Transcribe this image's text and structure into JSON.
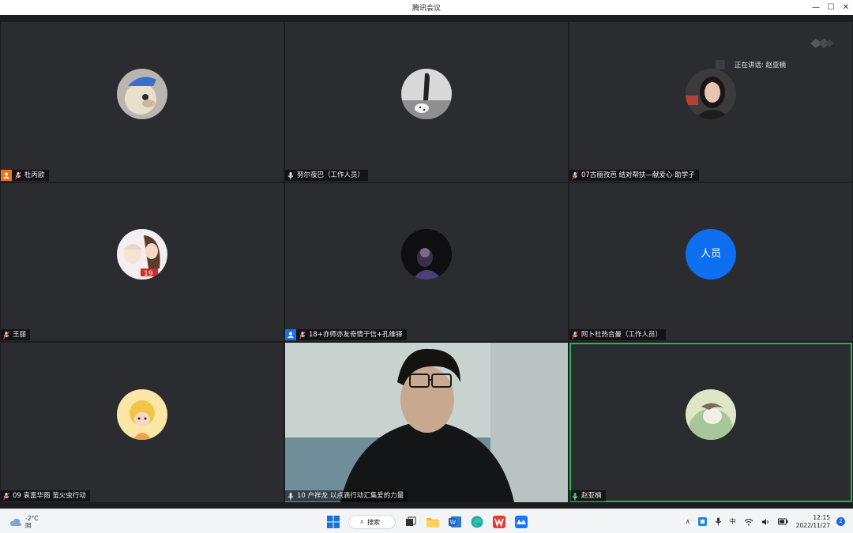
{
  "window": {
    "title": "腾讯会议",
    "min": "—",
    "max": "☐",
    "close": "✕"
  },
  "speaking": {
    "label": "正在讲话: 赵亚楠"
  },
  "participants": [
    {
      "name": "杜丙欧",
      "host": "orange",
      "mic": "muted"
    },
    {
      "name": "努尔夜巴（工作人员）",
      "mic": "on"
    },
    {
      "name": "07古丽孜芭 结对帮扶—献爱心·助学子",
      "mic": "muted"
    },
    {
      "name": "王丽",
      "mic": "muted"
    },
    {
      "name": "18+亦师亦友奇情于信+孔维铎",
      "host": "blue",
      "mic": "muted"
    },
    {
      "name": "阿卜杜热合曼（工作人员）",
      "avatar_text": "人员",
      "mic": "muted"
    },
    {
      "name": "09 袁富华雨 萤火虫行动",
      "mic": "muted"
    },
    {
      "name": "10 户祥龙 以点滴行动汇集爱的力量",
      "mic": "on",
      "video": true
    },
    {
      "name": "赵亚楠",
      "mic": "speaking",
      "active": true
    }
  ],
  "taskbar": {
    "weather_temp": "-2°C",
    "weather_desc": "阴",
    "search_label": "搜索",
    "ime": "中",
    "time": "12:15",
    "date": "2022/11/27",
    "notifications": "2"
  },
  "colors": {
    "speaking_border": "#27b35a",
    "avatar_blue": "#0e6ff0",
    "host_orange": "#f0731a",
    "host_blue": "#1d6fe8"
  }
}
